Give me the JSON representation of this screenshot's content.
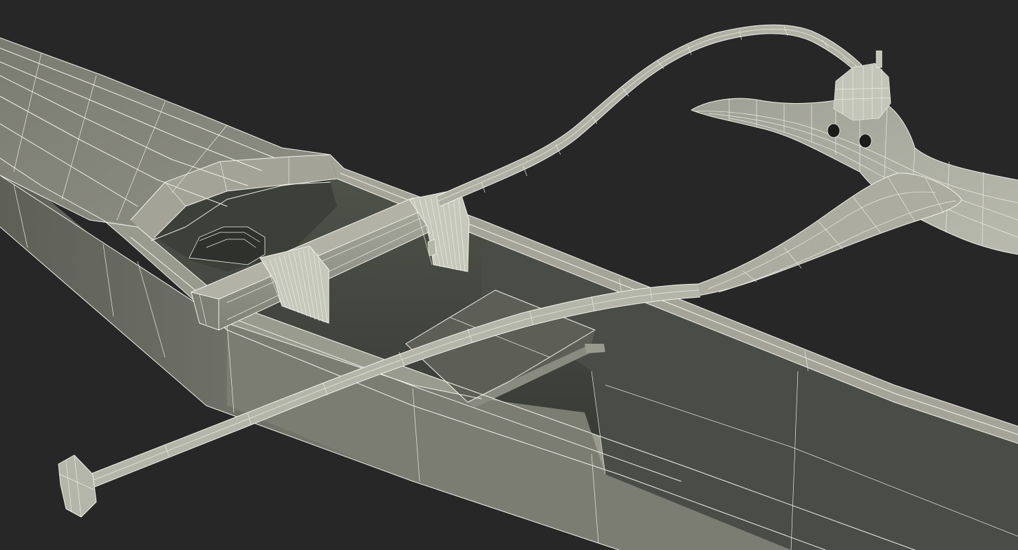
{
  "scene": {
    "subject": "outrigger-canoe-wireframe-render",
    "background_color": "#272727",
    "surface_color": "#8a8a80",
    "surface_light_color": "#a7a79b",
    "surface_dark_color": "#55574f",
    "interior_color": "#3b3e37",
    "wire_color": "#f2f2ea"
  }
}
